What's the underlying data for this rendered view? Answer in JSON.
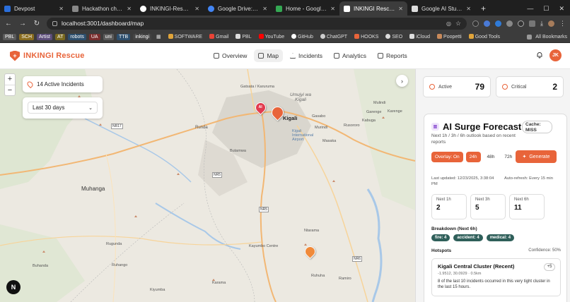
{
  "browser": {
    "tabs": [
      {
        "title": "Devpost",
        "color": "#2a6edb"
      },
      {
        "title": "Hackathon chances",
        "color": "#aaaaaa"
      },
      {
        "title": "INKINGI-Rescue/INKI",
        "color": "#ffffff"
      },
      {
        "title": "Google Drive: Share",
        "color": "#4285f4"
      },
      {
        "title": "Home - Google Drive",
        "color": "#34a853"
      },
      {
        "title": "INKINGI Rescue - Re",
        "color": "#ffffff"
      },
      {
        "title": "Google AI Studio",
        "color": "#ffffff"
      }
    ],
    "active_tab": 5,
    "url": "localhost:3001/dashboard/map",
    "bookmarks": [
      "PBL",
      "SCH",
      "Artist",
      "AT",
      "robots",
      "UA",
      "uni",
      "TTB",
      "inkingi"
    ],
    "bookmark_links": [
      "SOFTWARE",
      "Gmail",
      "PBL",
      "YouTube",
      "GitHub",
      "ChatGPT",
      "HOOKS",
      "SEO",
      "iCloud",
      "Poopetti",
      "Good Tools"
    ],
    "all_bookmarks": "All Bookmarks"
  },
  "app": {
    "brand": "INKINGI Rescue",
    "brand_color": "#e8643a",
    "nav": [
      "Overview",
      "Map",
      "Incidents",
      "Analytics",
      "Reports"
    ],
    "active_nav": "Map",
    "user_initials": "JK"
  },
  "map": {
    "active_incidents": "14 Active Incidents",
    "range": "Last 30 days",
    "labels": {
      "gatsata": "Gatsata / Karuruma",
      "umujyi": "Umujyi wa Kigali",
      "kigali": "Kigali",
      "kigali_airport": "Kigali International Airport",
      "runda": "Runda",
      "butamwa": "Butamwa",
      "muhanga": "Muhanga",
      "gasabo": "Gasabo",
      "murindi": "Murindi",
      "masaka": "Masaka",
      "rusororo": "Rusororo",
      "kabuga": "Kabuga",
      "karenge": "Karenge",
      "garenge": "Garenge",
      "mulindi": "Mulindi",
      "kayumbo": "Kayumbo Centre",
      "rugunda": "Rugunda",
      "buhanda": "Buhanda",
      "ruhango": "Ruhango",
      "ntarama": "Ntarama",
      "ruhuha": "Ruhuha",
      "kiyumba": "Kiyumba",
      "karama": "Karama",
      "ramiro": "Ramiro"
    },
    "roads": [
      "NR17",
      "NR5",
      "NR6",
      "NR5"
    ],
    "marker_label": "AI"
  },
  "panel": {
    "active_label": "Active",
    "active_value": "79",
    "critical_label": "Critical",
    "critical_value": "2",
    "forecast_title": "AI Surge Forecast",
    "cache_label": "Cache:",
    "cache_value": "MISS",
    "subtitle": "Next 1h / 3h / 6h outlook based on recent reports",
    "overlay": "Overlay: On",
    "windows": [
      "24h",
      "48h",
      "72h"
    ],
    "active_window": "24h",
    "generate": "Generate",
    "last_updated": "Last updated: 12/23/2025, 3:38:04 PM",
    "auto_refresh": "Auto-refresh: Every 15 min",
    "horizons": [
      {
        "label": "Next 1h",
        "value": "2"
      },
      {
        "label": "Next 3h",
        "value": "5"
      },
      {
        "label": "Next 6h",
        "value": "11"
      }
    ],
    "breakdown_title": "Breakdown (Next 6h)",
    "breakdown": [
      "fire: 4",
      "accident: 4",
      "medical: 4"
    ],
    "hotspots_title": "Hotspots",
    "confidence": "Confidence: 50%",
    "hotspot": {
      "name": "Kigali Central Cluster (Recent)",
      "coords": "-1.9512, 30.0929 · 0.5km",
      "badge": "+5",
      "desc": "8 of the last 10 incidents occurred in this very tight cluster in the last 15 hours."
    }
  }
}
